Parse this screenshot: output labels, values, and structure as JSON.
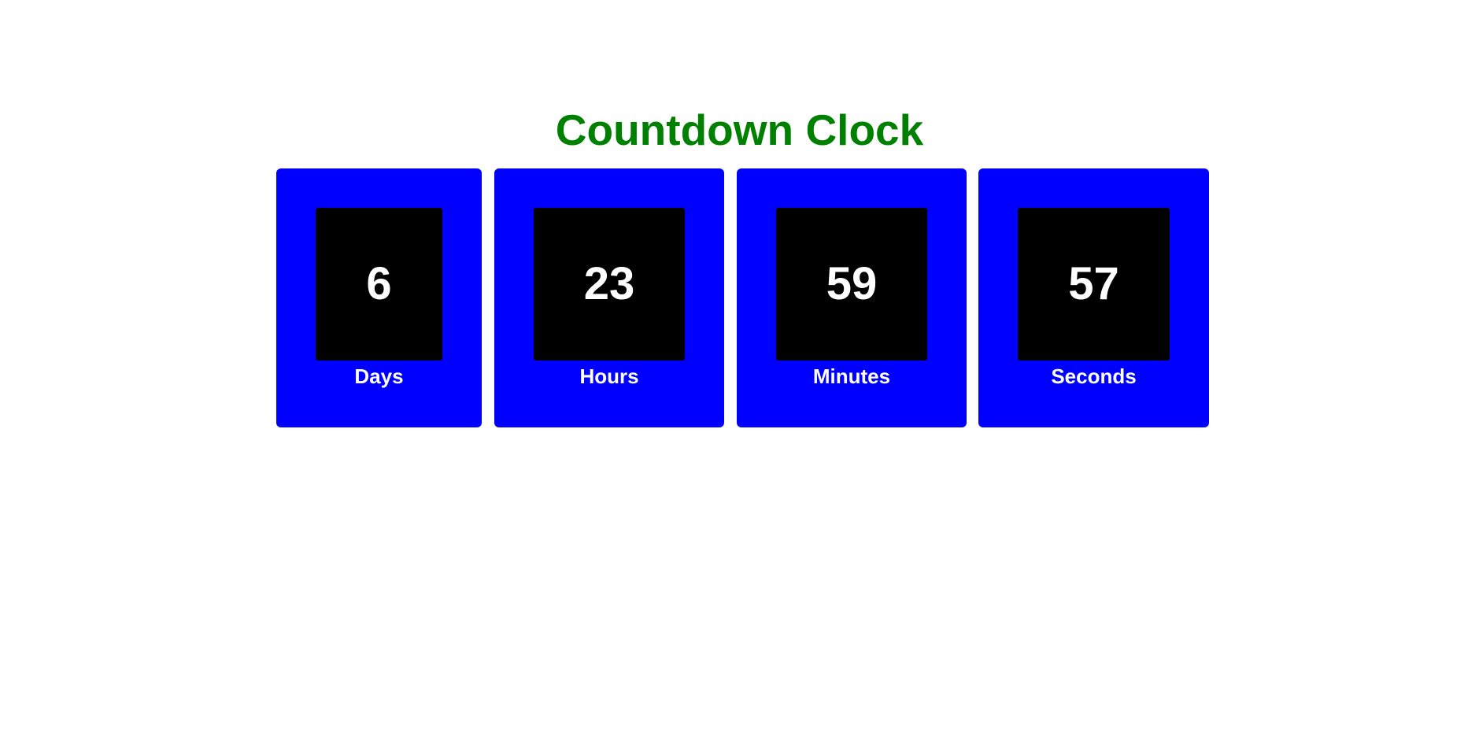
{
  "page": {
    "title": "Countdown Clock"
  },
  "colors": {
    "title": "#008000",
    "card_background": "#0000ff",
    "value_box_background": "#000000",
    "text": "#ffffff"
  },
  "countdown": {
    "days": {
      "value": "6",
      "label": "Days"
    },
    "hours": {
      "value": "23",
      "label": "Hours"
    },
    "minutes": {
      "value": "59",
      "label": "Minutes"
    },
    "seconds": {
      "value": "57",
      "label": "Seconds"
    }
  }
}
